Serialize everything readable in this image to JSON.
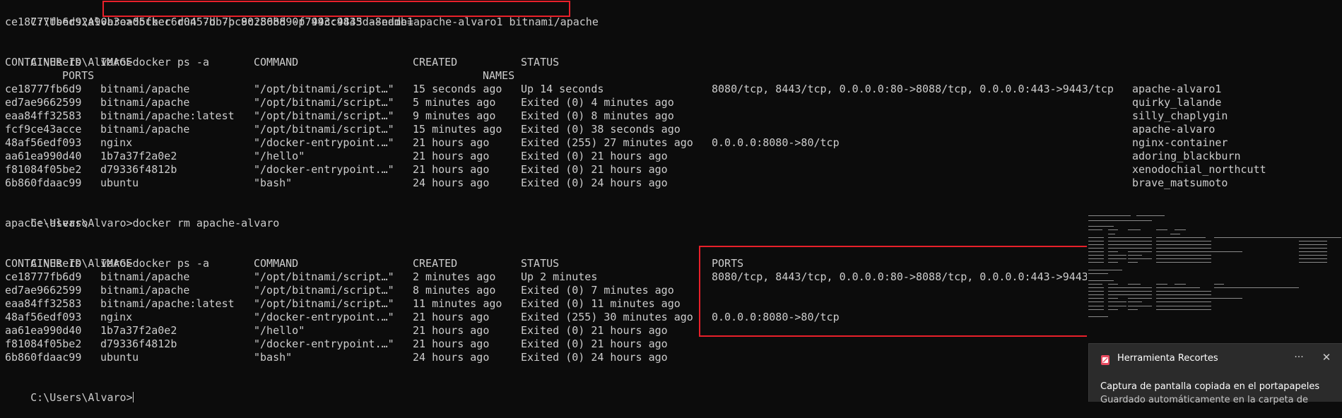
{
  "terminal": {
    "prompt": "C:\\Users\\Alvaro>",
    "cmd_run": "docker run -d -p 80:8088 -p 443:9443 --name=apache-alvaro1 bitnami/apache",
    "run_output": "ce18777fb6d92a90b3ea05fbec6d0457bb7bc9c256bd90f799cc4835da8eddb1",
    "cmd_ps": "docker ps -a",
    "cmd_rm": "docker rm apache-alvaro",
    "rm_output": "apache-alvaro",
    "headers": {
      "container_id": "CONTAINER ID",
      "image": "IMAGE",
      "command": "COMMAND",
      "created": "CREATED",
      "status": "STATUS",
      "ports": "PORTS",
      "names": "NAMES"
    },
    "ps1_rows": [
      {
        "id": "ce18777fb6d9",
        "image": "bitnami/apache",
        "command": "\"/opt/bitnami/script…\"",
        "created": "15 seconds ago",
        "status": "Up 14 seconds",
        "ports": "8080/tcp, 8443/tcp, 0.0.0.0:80->8088/tcp, 0.0.0.0:443->9443/tcp",
        "name": "apache-alvaro1"
      },
      {
        "id": "ed7ae9662599",
        "image": "bitnami/apache",
        "command": "\"/opt/bitnami/script…\"",
        "created": "5 minutes ago",
        "status": "Exited (0) 4 minutes ago",
        "ports": "",
        "name": "quirky_lalande"
      },
      {
        "id": "eaa84ff32583",
        "image": "bitnami/apache:latest",
        "command": "\"/opt/bitnami/script…\"",
        "created": "9 minutes ago",
        "status": "Exited (0) 8 minutes ago",
        "ports": "",
        "name": "silly_chaplygin"
      },
      {
        "id": "fcf9ce43acce",
        "image": "bitnami/apache",
        "command": "\"/opt/bitnami/script…\"",
        "created": "15 minutes ago",
        "status": "Exited (0) 38 seconds ago",
        "ports": "",
        "name": "apache-alvaro"
      },
      {
        "id": "48af56edf093",
        "image": "nginx",
        "command": "\"/docker-entrypoint.…\"",
        "created": "21 hours ago",
        "status": "Exited (255) 27 minutes ago",
        "ports": "0.0.0.0:8080->80/tcp",
        "name": "nginx-container"
      },
      {
        "id": "aa61ea990d40",
        "image": "1b7a37f2a0e2",
        "command": "\"/hello\"",
        "created": "21 hours ago",
        "status": "Exited (0) 21 hours ago",
        "ports": "",
        "name": "adoring_blackburn"
      },
      {
        "id": "f81084f05be2",
        "image": "d79336f4812b",
        "command": "\"/docker-entrypoint.…\"",
        "created": "21 hours ago",
        "status": "Exited (0) 21 hours ago",
        "ports": "",
        "name": "xenodochial_northcutt"
      },
      {
        "id": "6b860fdaac99",
        "image": "ubuntu",
        "command": "\"bash\"",
        "created": "24 hours ago",
        "status": "Exited (0) 24 hours ago",
        "ports": "",
        "name": "brave_matsumoto"
      }
    ],
    "ps2_rows": [
      {
        "id": "ce18777fb6d9",
        "image": "bitnami/apache",
        "command": "\"/opt/bitnami/script…\"",
        "created": "2 minutes ago",
        "status": "Up 2 minutes",
        "ports": "8080/tcp, 8443/tcp, 0.0.0.0:80->8088/tcp, 0.0.0.0:443->9443"
      },
      {
        "id": "ed7ae9662599",
        "image": "bitnami/apache",
        "command": "\"/opt/bitnami/script…\"",
        "created": "8 minutes ago",
        "status": "Exited (0) 7 minutes ago",
        "ports": ""
      },
      {
        "id": "eaa84ff32583",
        "image": "bitnami/apache:latest",
        "command": "\"/opt/bitnami/script…\"",
        "created": "11 minutes ago",
        "status": "Exited (0) 11 minutes ago",
        "ports": ""
      },
      {
        "id": "48af56edf093",
        "image": "nginx",
        "command": "\"/docker-entrypoint.…\"",
        "created": "21 hours ago",
        "status": "Exited (255) 30 minutes ago",
        "ports": "0.0.0.0:8080->80/tcp"
      },
      {
        "id": "aa61ea990d40",
        "image": "1b7a37f2a0e2",
        "command": "\"/hello\"",
        "created": "21 hours ago",
        "status": "Exited (0) 21 hours ago",
        "ports": ""
      },
      {
        "id": "f81084f05be2",
        "image": "d79336f4812b",
        "command": "\"/docker-entrypoint.…\"",
        "created": "21 hours ago",
        "status": "Exited (0) 21 hours ago",
        "ports": ""
      },
      {
        "id": "6b860fdaac99",
        "image": "ubuntu",
        "command": "\"bash\"",
        "created": "24 hours ago",
        "status": "Exited (0) 24 hours ago",
        "ports": ""
      }
    ]
  },
  "toast": {
    "app_name": "Herramienta Recortes",
    "more_label": "···",
    "close_label": "✕",
    "title": "Captura de pantalla copiada en el portapapeles",
    "body": "Guardado automáticamente en la carpeta de",
    "icon": "scissors-icon"
  },
  "colors": {
    "background": "#0c0c0c",
    "text": "#cccccc",
    "highlight": "#e8202a",
    "toast_bg": "#2b2b2b"
  }
}
